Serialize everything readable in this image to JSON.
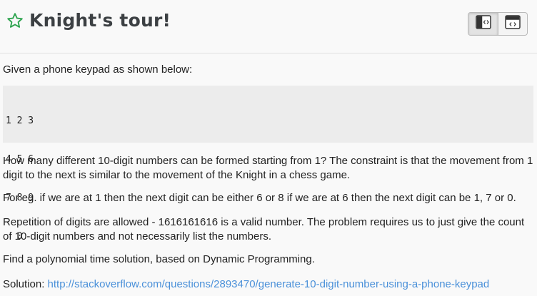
{
  "header": {
    "title": "Knight's tour!",
    "star_icon": "star-outline-icon",
    "star_color": "#2ea44f",
    "buttons": [
      {
        "name": "split-view-button",
        "icon": "split-code-view-icon"
      },
      {
        "name": "full-view-button",
        "icon": "full-code-view-icon"
      }
    ]
  },
  "content": {
    "intro": "Given a phone keypad as shown below:",
    "keypad_lines": [
      "1 2 3",
      "4 5 6",
      "7 8 9",
      "  0"
    ],
    "paragraph1": "How many different 10-digit numbers can be formed starting from 1? The constraint is that the movement from 1 digit to the next is similar to the movement of the Knight in a chess game.",
    "paragraph2": "For eg. if we are at 1 then the next digit can be either 6 or 8 if we are at 6 then the next digit can be 1, 7 or 0.",
    "paragraph3": "Repetition of digits are allowed - 1616161616 is a valid number. The problem requires us to just give the count of 10-digit numbers and not necessarily list the numbers.",
    "paragraph4": "Find a polynomial time solution, based on Dynamic Programming.",
    "solution_label": "Solution:",
    "solution_link": "http://stackoverflow.com/questions/2893470/generate-10-digit-number-using-a-phone-keypad"
  },
  "colors": {
    "link": "#4a90d9",
    "code_background": "#ececec"
  }
}
